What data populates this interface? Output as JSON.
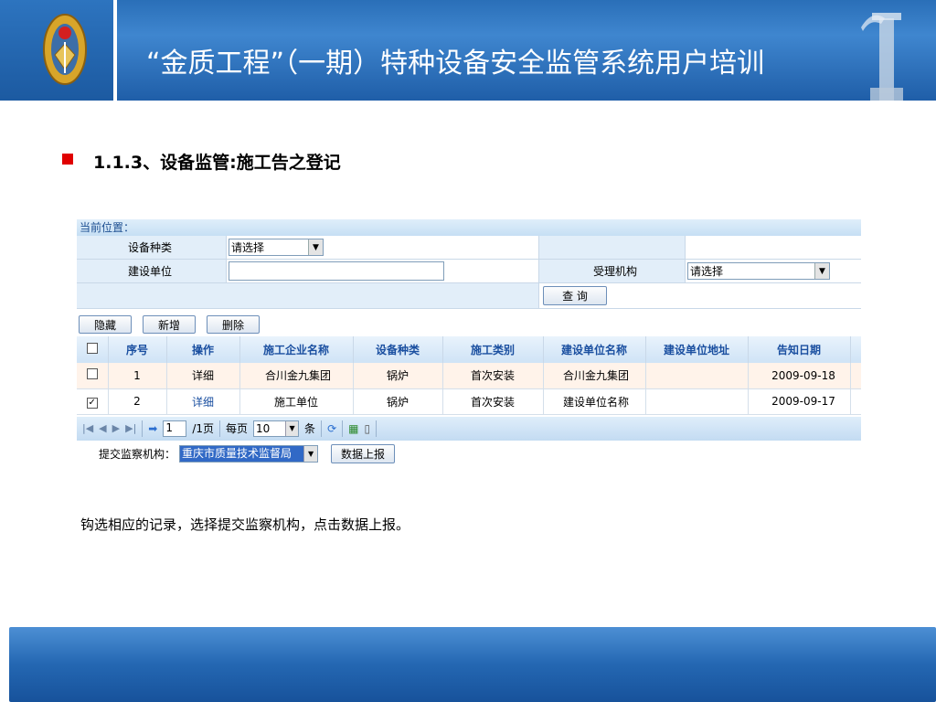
{
  "header": {
    "title": "“金质工程”（一期）特种设备安全监管系统用户培训",
    "logo": "emblem-logo"
  },
  "section": {
    "title": "1.1.3、设备监管:施工告之登记"
  },
  "app": {
    "location_label": "当前位置：",
    "form": {
      "equipment_type_label": "设备种类",
      "equipment_type_value": "请选择",
      "build_unit_label": "建设单位",
      "build_unit_value": "",
      "accept_org_label": "受理机构",
      "accept_org_value": "请选择",
      "query_button": "查  询"
    },
    "toolbar": {
      "hide": "隐藏",
      "add": "新增",
      "delete": "删除"
    },
    "table": {
      "columns": [
        "序号",
        "操作",
        "施工企业名称",
        "设备种类",
        "施工类别",
        "建设单位名称",
        "建设单位地址",
        "告知日期"
      ],
      "rows": [
        {
          "checked": false,
          "no": "1",
          "op": "详细",
          "company": "合川金九集团",
          "type": "锅炉",
          "category": "首次安装",
          "unit": "合川金九集团",
          "address": "",
          "date": "2009-09-18"
        },
        {
          "checked": true,
          "no": "2",
          "op": "详细",
          "company": "施工单位",
          "type": "锅炉",
          "category": "首次安装",
          "unit": "建设单位名称",
          "address": "",
          "date": "2009-09-17"
        }
      ]
    },
    "pager": {
      "page_value": "1",
      "page_total": "/1页",
      "per_page_label": "每页",
      "per_page_value": "10",
      "per_page_unit": "条"
    },
    "submit": {
      "label": "提交监察机构：",
      "org_value": "重庆市质量技术监督局",
      "button": "数据上报"
    }
  },
  "caption": "钩选相应的记录，选择提交监察机构，点击数据上报。",
  "colors": {
    "header_blue": "#2a6fb8",
    "bullet_red": "#e00000",
    "link_blue": "#1a4fa0"
  }
}
